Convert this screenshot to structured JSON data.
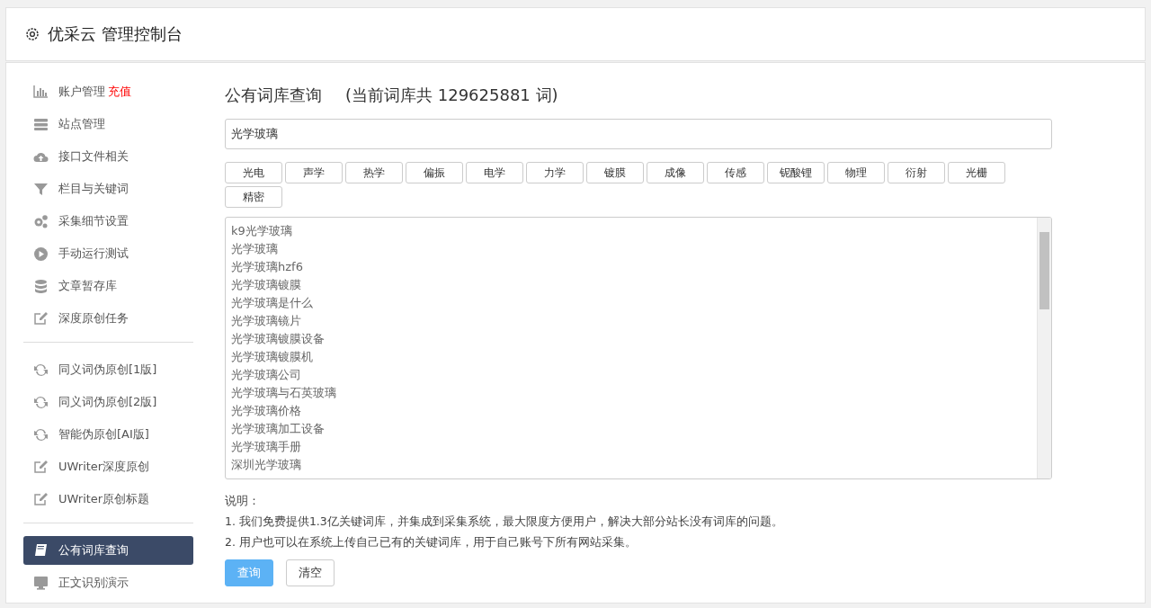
{
  "header": {
    "title": "优采云 管理控制台"
  },
  "sidebar": {
    "groups": [
      [
        {
          "label": "账户管理",
          "badge": "充值",
          "kind": "chart",
          "selected": false
        },
        {
          "label": "站点管理",
          "kind": "server",
          "selected": false
        },
        {
          "label": "接口文件相关",
          "kind": "cloud",
          "selected": false
        },
        {
          "label": "栏目与关键词",
          "kind": "filter",
          "selected": false
        },
        {
          "label": "采集细节设置",
          "kind": "gears",
          "selected": false
        },
        {
          "label": "手动运行测试",
          "kind": "play",
          "selected": false
        },
        {
          "label": "文章暂存库",
          "kind": "database",
          "selected": false
        },
        {
          "label": "深度原创任务",
          "kind": "edit",
          "selected": false
        }
      ],
      [
        {
          "label": "同义词伪原创[1版]",
          "kind": "refresh",
          "selected": false
        },
        {
          "label": "同义词伪原创[2版]",
          "kind": "refresh",
          "selected": false
        },
        {
          "label": "智能伪原创[AI版]",
          "kind": "refresh",
          "selected": false
        },
        {
          "label": "UWriter深度原创",
          "kind": "edit",
          "selected": false
        },
        {
          "label": "UWriter原创标题",
          "kind": "edit",
          "selected": false
        }
      ],
      [
        {
          "label": "公有词库查询",
          "kind": "book",
          "selected": true
        },
        {
          "label": "正文识别演示",
          "kind": "monitor",
          "selected": false
        }
      ]
    ]
  },
  "main": {
    "title": "公有词库查询",
    "count_text": "(当前词库共 129625881 词)",
    "search_value": "光学玻璃",
    "tags": [
      "光电",
      "声学",
      "热学",
      "偏振",
      "电学",
      "力学",
      "镀膜",
      "成像",
      "传感",
      "铌酸锂",
      "物理",
      "衍射",
      "光栅",
      "精密"
    ],
    "results": [
      "k9光学玻璃",
      "光学玻璃",
      "光学玻璃hzf6",
      "光学玻璃镀膜",
      "光学玻璃是什么",
      "光学玻璃镜片",
      "光学玻璃镀膜设备",
      "光学玻璃镀膜机",
      "光学玻璃公司",
      "光学玻璃与石英玻璃",
      "光学玻璃价格",
      "光学玻璃加工设备",
      "光学玻璃手册",
      "深圳光学玻璃"
    ],
    "notes_title": "说明：",
    "notes": [
      "1. 我们免费提供1.3亿关键词库，并集成到采集系统，最大限度方便用户，解决大部分站长没有词库的问题。",
      "2. 用户也可以在系统上传自己已有的关键词库，用于自己账号下所有网站采集。"
    ],
    "buttons": [
      {
        "label": "查询",
        "kind": "primary"
      },
      {
        "label": "清空",
        "kind": "default"
      }
    ]
  }
}
